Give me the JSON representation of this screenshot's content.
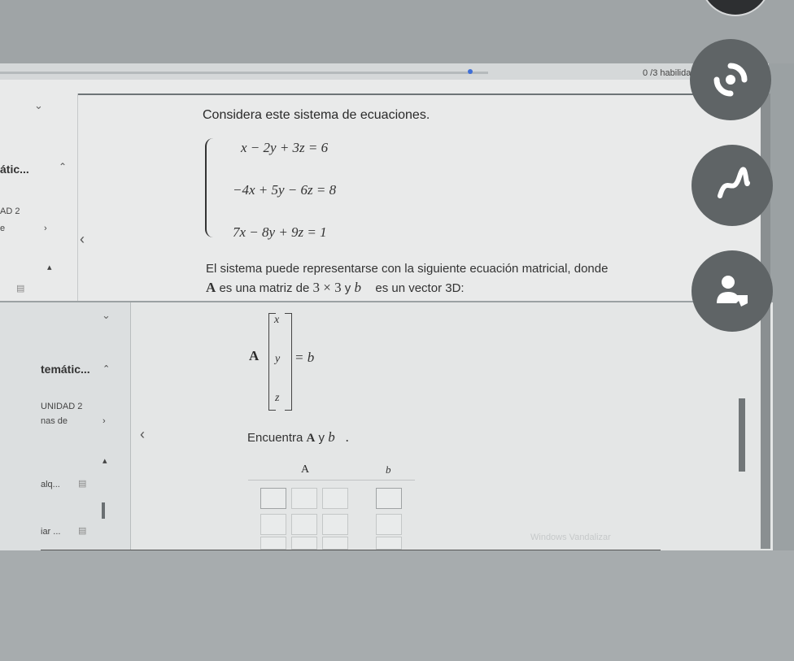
{
  "header": {
    "progress": "0 /3 habilidades"
  },
  "sidebar_top": {
    "section": "átic...",
    "unit": "AD 2",
    "item": "e"
  },
  "question": {
    "intro": "Considera este sistema de ecuaciones.",
    "equations": [
      "x − 2y + 3z = 6",
      "−4x + 5y − 6z = 8",
      "7x − 8y + 9z = 1"
    ],
    "matrix_text_1": "El sistema puede representarse con la siguiente ecuación matricial, donde",
    "matrix_text_2a": "A",
    "matrix_text_2b": " es una matriz de ",
    "matrix_text_2c": "3 × 3",
    "matrix_text_2d": " y ",
    "matrix_text_2e": "b⃗",
    "matrix_text_2f": " es un vector 3D:"
  },
  "equation_display": {
    "A": "A",
    "vector": [
      "x",
      "y",
      "z"
    ],
    "rhs": "= b⃗"
  },
  "prompt": {
    "text": "Encuentra ",
    "A": "A",
    "y": " y ",
    "b": "b⃗."
  },
  "answer_table": {
    "col_A": "A",
    "col_b": "b⃗"
  },
  "sidebar_bottom": {
    "section": "temátic...",
    "unit": "UNIDAD 2",
    "item": "nas de",
    "item2": "alq...",
    "item3": "iar ..."
  },
  "watermark": "Windows Vandalizar",
  "floating_buttons": [
    "refresh-icon",
    "pen-icon",
    "user-tag-icon"
  ]
}
